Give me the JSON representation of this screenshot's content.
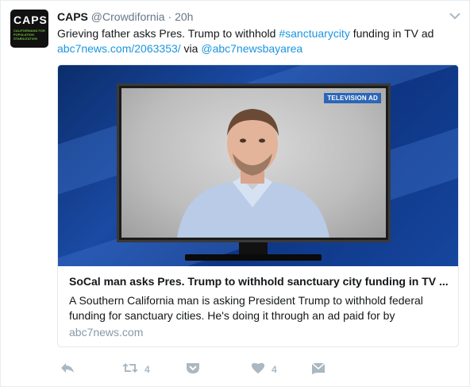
{
  "tweet": {
    "avatar": {
      "logo_text": "CAPS",
      "logo_subtext": "Californians for Population Stabilization"
    },
    "fullname": "CAPS",
    "screenname": "@Crowdifornia",
    "separator": "·",
    "time": "20h",
    "text": {
      "part1": "Grieving father asks Pres. Trump to withhold ",
      "hashtag": "#sanctuarycity",
      "part2": " funding in TV ad",
      "url": "abc7news.com/2063353/",
      "via": " via ",
      "mention": "@abc7newsbayarea"
    },
    "card": {
      "image_label": "TELEVISION AD",
      "title": "SoCal man asks Pres. Trump to withhold sanctuary city funding in TV ...",
      "description": "A Southern California man is asking President Trump to withhold federal funding for sanctuary cities. He's doing it through an ad paid for by",
      "domain": "abc7news.com"
    },
    "actions": {
      "reply_icon": "reply-icon",
      "retweet_icon": "retweet-icon",
      "retweet_count": "4",
      "pocket_icon": "pocket-icon",
      "like_icon": "heart-icon",
      "like_count": "4",
      "dm_icon": "envelope-icon"
    },
    "colors": {
      "link": "#1b95e0",
      "muted": "#657786",
      "action": "#aab8c2"
    }
  }
}
